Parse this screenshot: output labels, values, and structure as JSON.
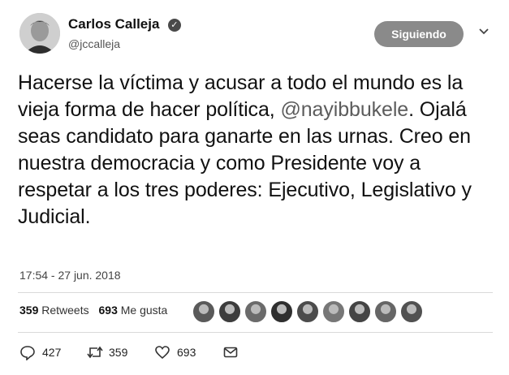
{
  "author": {
    "name": "Carlos Calleja",
    "handle": "@jccalleja",
    "verified_icon": "verified-badge-icon"
  },
  "follow_button": {
    "label": "Siguiendo"
  },
  "tweet": {
    "text_before": "Hacerse la víctima y acusar a todo el mundo es la vieja forma de hacer política,",
    "mention": "@nayibbukele",
    "text_after": ". Ojalá seas candidato para ganarte en las urnas. Creo en nuestra democracia y como Presidente voy a respetar a los tres poderes: Ejecutivo, Legislativo y Judicial."
  },
  "timestamp": "17:54 - 27 jun. 2018",
  "stats": {
    "retweets_count": "359",
    "retweets_label": "Retweets",
    "likes_count": "693",
    "likes_label": "Me gusta"
  },
  "liker_avatars": 9,
  "actions": {
    "replies": "427",
    "retweets": "359",
    "likes": "693"
  },
  "colors": {
    "follow_button": "#8a8a8a",
    "mention": "#5c5c5c",
    "divider": "#d9d9d9"
  }
}
